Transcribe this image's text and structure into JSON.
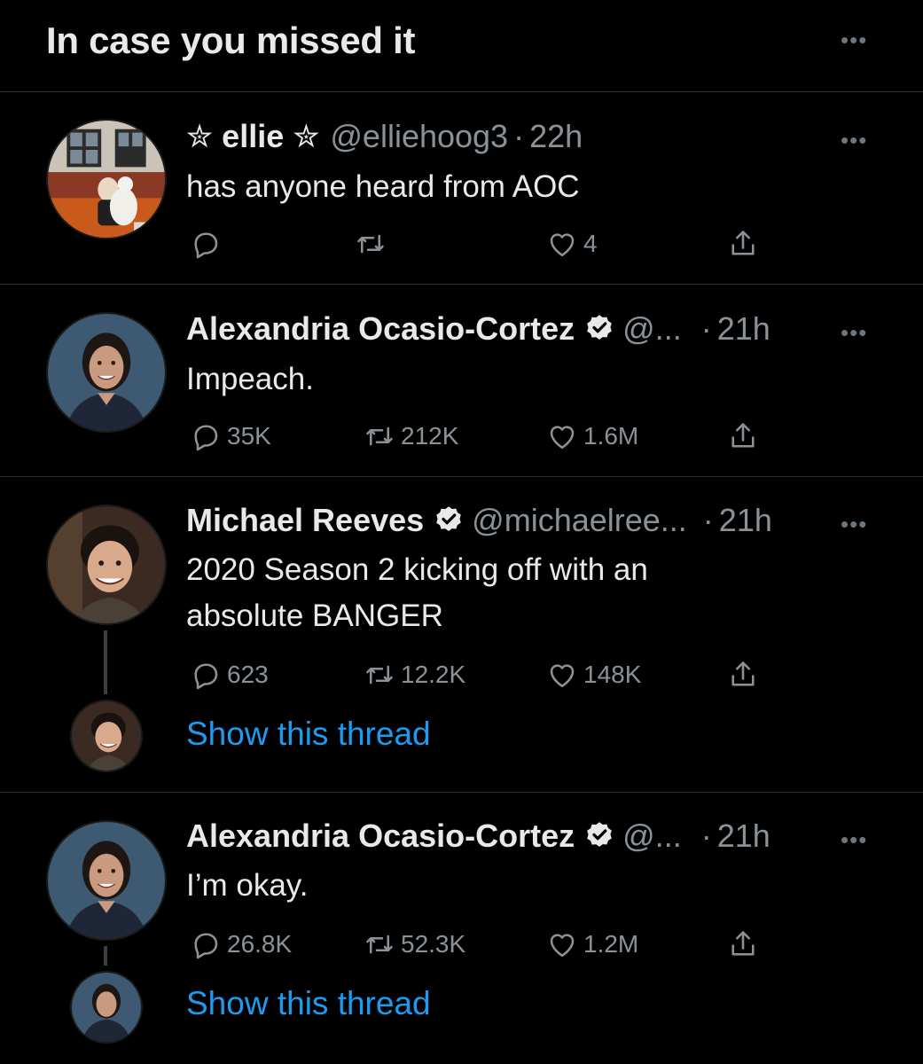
{
  "header": {
    "title": "In case you missed it"
  },
  "icons": {
    "more": "more-horizontal-icon",
    "reply": "reply-icon",
    "retweet": "retweet-icon",
    "like": "heart-icon",
    "share": "share-icon",
    "verified": "verified-badge-icon"
  },
  "colors": {
    "background": "#000000",
    "text_primary": "#e7e9ea",
    "text_secondary": "#8b9297",
    "link": "#1d9bf0",
    "divider": "#2f3336"
  },
  "more_glyph": "•••",
  "tweets": [
    {
      "display_name": "✮ ellie ✮",
      "handle": "@elliehoog3",
      "separator": "·",
      "time": "22h",
      "text": "has anyone heard from AOC",
      "replies": "",
      "retweets": "",
      "likes": "4"
    },
    {
      "display_name": "Alexandria Ocasio-Cortez",
      "verified": true,
      "handle": "@...",
      "separator": "·",
      "time": "21h",
      "text": "Impeach.",
      "replies": "35K",
      "retweets": "212K",
      "likes": "1.6M"
    },
    {
      "display_name": "Michael Reeves",
      "verified": true,
      "handle": "@michaelree...",
      "separator": "·",
      "time": "21h",
      "text_line1": "2020 Season 2 kicking off with an",
      "text_line2": "absolute BANGER",
      "replies": "623",
      "retweets": "12.2K",
      "likes": "148K",
      "thread_link": "Show this thread"
    },
    {
      "display_name": "Alexandria Ocasio-Cortez",
      "verified": true,
      "handle": "@...",
      "separator": "·",
      "time": "21h",
      "text": "I’m okay.",
      "replies": "26.8K",
      "retweets": "52.3K",
      "likes": "1.2M",
      "thread_link": "Show this thread"
    }
  ]
}
